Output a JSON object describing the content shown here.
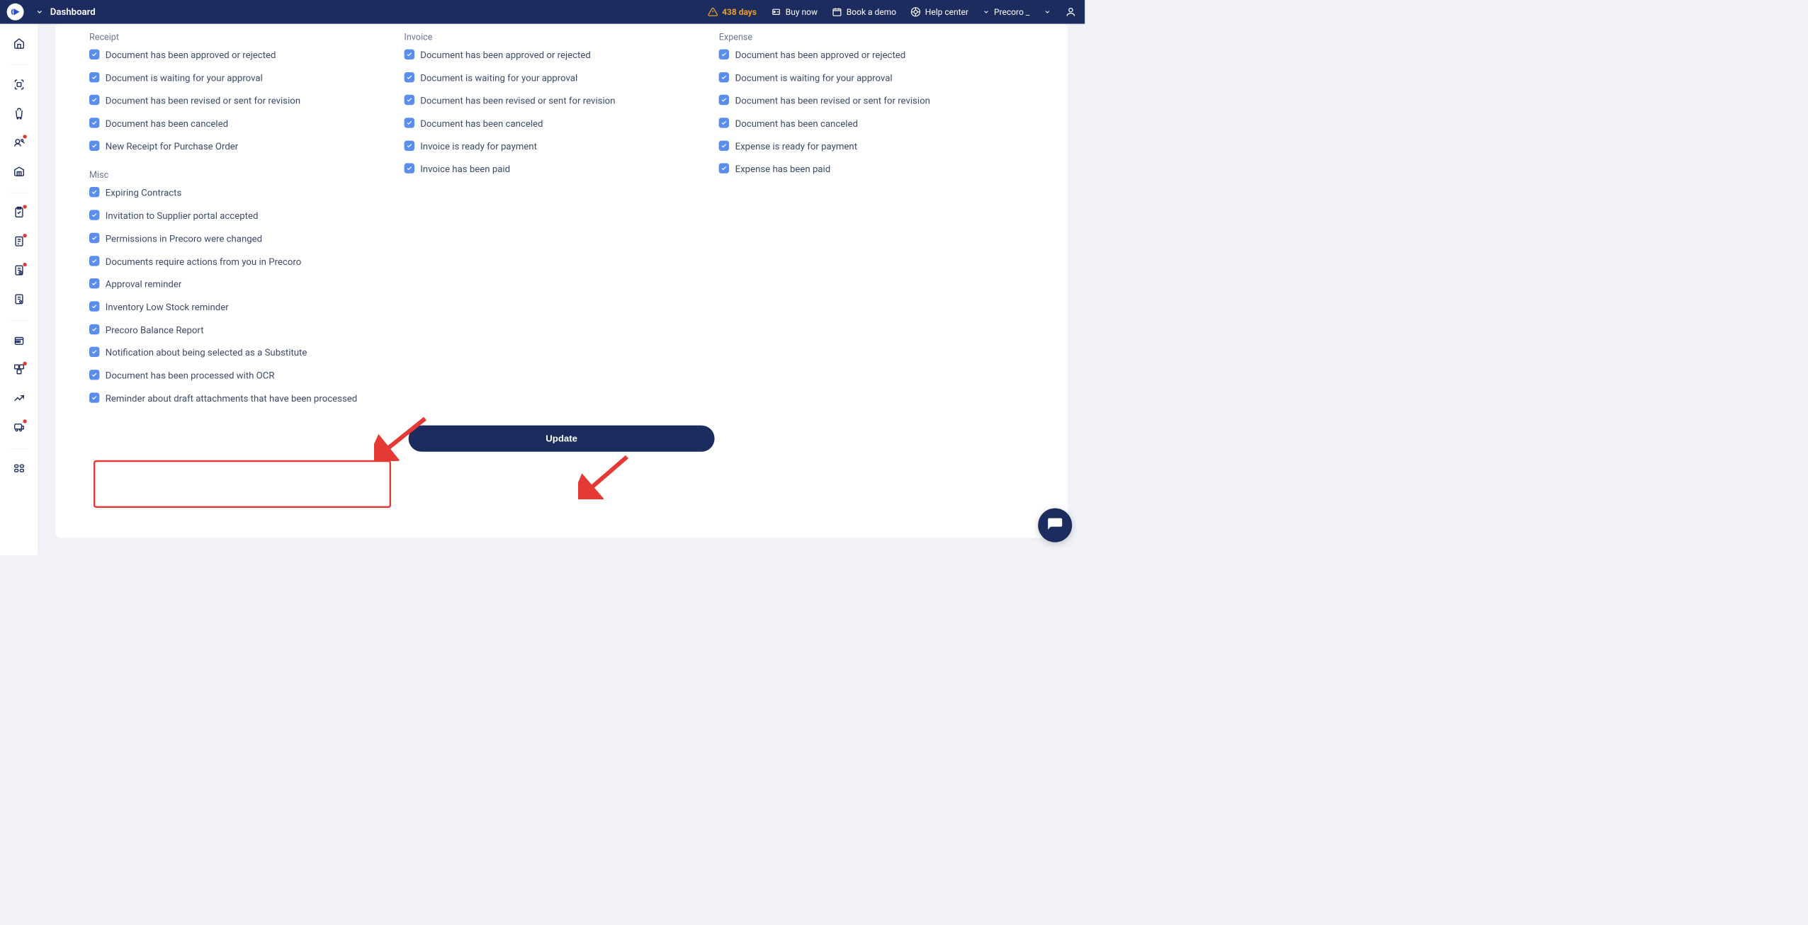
{
  "topbar": {
    "title": "Dashboard",
    "trial_days": "438 days",
    "buy_now": "Buy now",
    "book_demo": "Book a demo",
    "help_center": "Help center",
    "company": "Precoro _"
  },
  "sections": {
    "receipt": {
      "title": "Receipt",
      "items": [
        "Document has been approved or rejected",
        "Document is waiting for your approval",
        "Document has been revised or sent for revision",
        "Document has been canceled",
        "New Receipt for Purchase Order"
      ]
    },
    "invoice": {
      "title": "Invoice",
      "items": [
        "Document has been approved or rejected",
        "Document is waiting for your approval",
        "Document has been revised or sent for revision",
        "Document has been canceled",
        "Invoice is ready for payment",
        "Invoice has been paid"
      ]
    },
    "expense": {
      "title": "Expense",
      "items": [
        "Document has been approved or rejected",
        "Document is waiting for your approval",
        "Document has been revised or sent for revision",
        "Document has been canceled",
        "Expense is ready for payment",
        "Expense has been paid"
      ]
    },
    "misc": {
      "title": "Misc",
      "items": [
        "Expiring Contracts",
        "Invitation to Supplier portal accepted",
        "Permissions in Precoro were changed",
        "Documents require actions from you in Precoro",
        "Approval reminder",
        "Inventory Low Stock reminder",
        "Precoro Balance Report",
        "Notification about being selected as a Substitute",
        "Document has been processed with OCR",
        "Reminder about draft attachments that have been processed"
      ]
    }
  },
  "buttons": {
    "update": "Update"
  }
}
